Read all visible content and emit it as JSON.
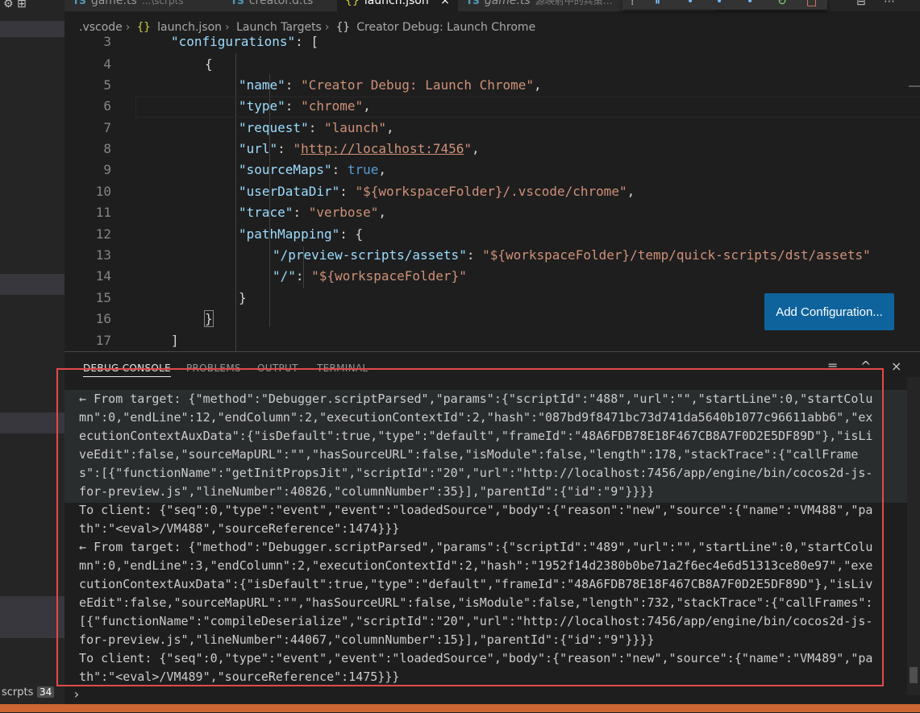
{
  "tabs": [
    {
      "name": "game.ts",
      "desc": "...\\scrpts",
      "type": "ts",
      "active": false
    },
    {
      "name": "creator.d.ts",
      "desc": "",
      "type": "ts",
      "active": false
    },
    {
      "name": "launch.json",
      "desc": "",
      "type": "json",
      "active": true
    },
    {
      "name": "game.ts",
      "desc": "源映射中的兵策…",
      "type": "ts",
      "active": false
    }
  ],
  "tab_close": "×",
  "breadcrumb": [
    ".vscode",
    "launch.json",
    "Launch Targets",
    "Creator Debug: Launch Chrome"
  ],
  "breadcrumb_icons": {
    "json": "{}",
    "object": "{}"
  },
  "editor": {
    "line_numbers": [
      "3",
      "4",
      "5",
      "6",
      "7",
      "8",
      "9",
      "10",
      "11",
      "12",
      "13",
      "14",
      "15",
      "16",
      "17"
    ],
    "lines": {
      "l3_key": "\"configurations\"",
      "l3_rest": ": [",
      "l4": "{",
      "l5_key": "\"name\"",
      "l5_val": "\"Creator Debug: Launch Chrome\"",
      "l6_key": "\"type\"",
      "l6_val": "\"chrome\"",
      "l7_key": "\"request\"",
      "l7_val": "\"launch\"",
      "l8_key": "\"url\"",
      "l8_val_q1": "\"",
      "l8_val": "http://localhost:7456",
      "l8_val_q2": "\"",
      "l9_key": "\"sourceMaps\"",
      "l9_val": "true",
      "l10_key": "\"userDataDir\"",
      "l10_val": "\"${workspaceFolder}/.vscode/chrome\"",
      "l11_key": "\"trace\"",
      "l11_val": "\"verbose\"",
      "l12_key": "\"pathMapping\"",
      "l12_rest": ": {",
      "l13_key": "\"/preview-scripts/assets\"",
      "l13_val": "\"${workspaceFolder}/temp/quick-scripts/dst/assets\"",
      "l14_key": "\"/\"",
      "l14_val": "\"${workspaceFolder}\"",
      "l15": "}",
      "l16": "}",
      "l17": "]"
    }
  },
  "add_configuration_label": "Add Configuration...",
  "panel": {
    "tabs": [
      "DEBUG CONSOLE",
      "PROBLEMS",
      "OUTPUT",
      "TERMINAL"
    ],
    "actions": {
      "menu_icon": "≡",
      "maximize_icon": "^",
      "close_icon": "×"
    },
    "console_lines": [
      "  ← From target: {\"method\":\"Debugger.scriptParsed\",\"params\":{\"scriptId\":\"488\",\"url\":\"\",\"startLine\":0,\"startColu",
      "  mn\":0,\"endLine\":12,\"endColumn\":2,\"executionContextId\":2,\"hash\":\"087bd9f8471bc73d741da5640b1077c96611abb6\",\"ex",
      "  ecutionContextAuxData\":{\"isDefault\":true,\"type\":\"default\",\"frameId\":\"48A6FDB78E18F467CB8A7F0D2E5DF89D\"},\"isLi",
      "  veEdit\":false,\"sourceMapURL\":\"\",\"hasSourceURL\":false,\"isModule\":false,\"length\":178,\"stackTrace\":{\"callFrame",
      "  s\":[{\"functionName\":\"getInitPropsJit\",\"scriptId\":\"20\",\"url\":\"http://localhost:7456/app/engine/bin/cocos2d-js-",
      "  for-preview.js\",\"lineNumber\":40826,\"columnNumber\":35}],\"parentId\":{\"id\":\"9\"}}}}",
      "  To client: {\"seq\":0,\"type\":\"event\",\"event\":\"loadedSource\",\"body\":{\"reason\":\"new\",\"source\":{\"name\":\"VM488\",\"pa",
      "  th\":\"<eval>/VM488\",\"sourceReference\":1474}}}",
      "  ← From target: {\"method\":\"Debugger.scriptParsed\",\"params\":{\"scriptId\":\"489\",\"url\":\"\",\"startLine\":0,\"startColu",
      "  mn\":0,\"endLine\":3,\"endColumn\":2,\"executionContextId\":2,\"hash\":\"1952f14d2380b0be71a2f6ec4e6d51313ce80e97\",\"exe",
      "  cutionContextAuxData\":{\"isDefault\":true,\"type\":\"default\",\"frameId\":\"48A6FDB78E18F467CB8A7F0D2E5DF89D\"},\"isLiv",
      "  eEdit\":false,\"sourceMapURL\":\"\",\"hasSourceURL\":false,\"isModule\":false,\"length\":732,\"stackTrace\":{\"callFrames\":",
      "  [{\"functionName\":\"compileDeserialize\",\"scriptId\":\"20\",\"url\":\"http://localhost:7456/app/engine/bin/cocos2d-js-",
      "  for-preview.js\",\"lineNumber\":44067,\"columnNumber\":15}],\"parentId\":{\"id\":\"9\"}}}}",
      "  To client: {\"seq\":0,\"type\":\"event\",\"event\":\"loadedSource\",\"body\":{\"reason\":\"new\",\"source\":{\"name\":\"VM489\",\"pa",
      "  th\":\"<eval>/VM489\",\"sourceReference\":1475}}}"
    ],
    "prompt": "›"
  },
  "sidebar": {
    "scripts_label": "scrpts",
    "scripts_count": "34"
  },
  "colors": {
    "accent_button": "#0e639c",
    "highlight_box": "#e34a4a",
    "status_bar": "#cc6633"
  }
}
